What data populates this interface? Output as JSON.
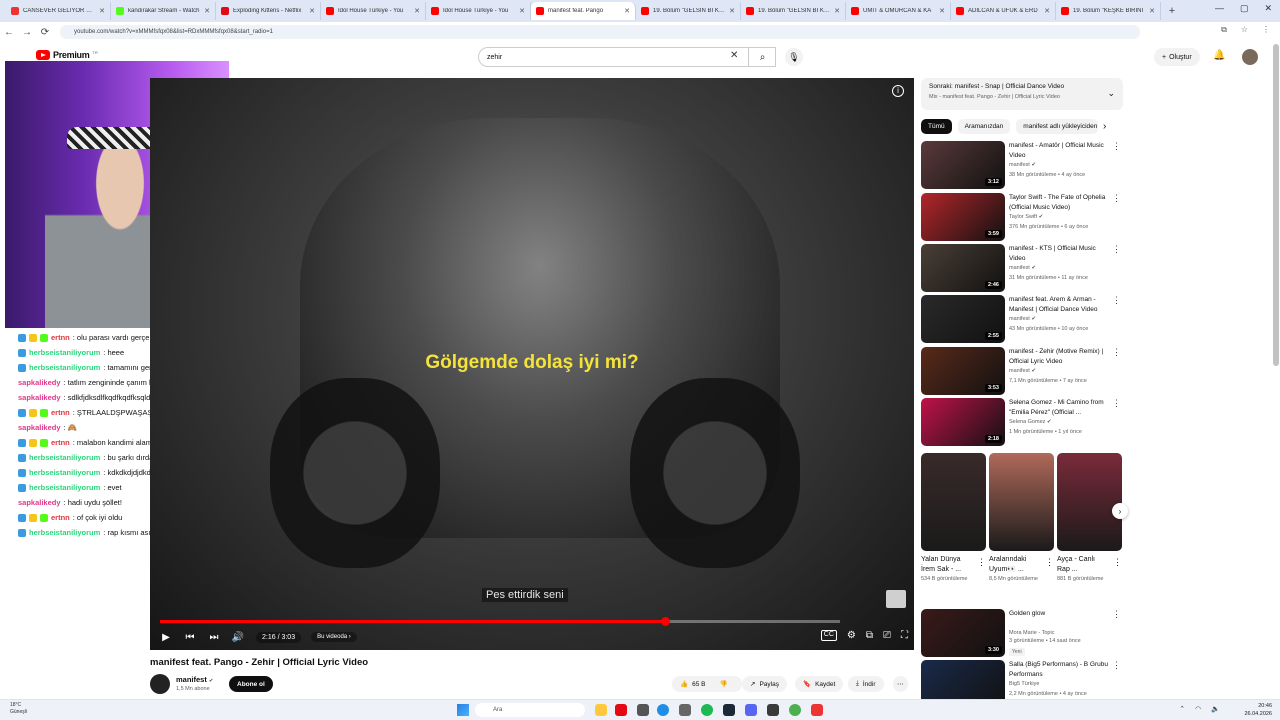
{
  "browser": {
    "tabs": [
      {
        "title": "CANSEVER GELİYOR GELİ",
        "color": "#e33"
      },
      {
        "title": "kandırakar Stream - Watch",
        "color": "#53fc18"
      },
      {
        "title": "Exploding Kittens - Netflix",
        "color": "#e50914"
      },
      {
        "title": "İdol House Türkiye - You",
        "color": "#f00"
      },
      {
        "title": "İdol House Türkiye - You",
        "color": "#f00"
      },
      {
        "title": "manifest feat. Pango",
        "color": "#f00",
        "active": true
      },
      {
        "title": "19. Bölüm \"GELSİN Bİ KİŞİ",
        "color": "#f00"
      },
      {
        "title": "19. Bölüm \"GELSİN Bİ KİŞİ",
        "color": "#f00"
      },
      {
        "title": "ÜMİT & OMURCAN & KA",
        "color": "#f00"
      },
      {
        "title": "ADİLCAN & UFUK & ERD",
        "color": "#f00"
      },
      {
        "title": "19. Bölüm \"KEŞKE BİRİNİ",
        "color": "#f00"
      }
    ],
    "new_tab": "+",
    "window_controls": {
      "minimize": "—",
      "maximize": "▢",
      "close": "✕"
    },
    "url": "youtube.com/watch?v=xMMMfsfqx08&list=RDxMMMfsfqx08&start_radio=1",
    "nav": {
      "back": "←",
      "forward": "→",
      "reload": "⟳"
    }
  },
  "header": {
    "logo_text": "Premium",
    "logo_cc": "TR",
    "search_value": "zehir",
    "search_clear": "✕",
    "search_icon": "⌕",
    "mic_icon": "🎙",
    "create_label": "Oluştur",
    "bell_icon": "🔔"
  },
  "chat": [
    {
      "user": "ertnn",
      "color": "#e0363c",
      "msg": ": olu parası vardı gerçek yatmadı",
      "badges": [
        "#3a9be0",
        "#f5c518",
        "#53fc18"
      ]
    },
    {
      "user": "herbseistaniliyorum",
      "color": "#29d67c",
      "msg": ": heee",
      "badges": [
        "#3a9be0"
      ]
    },
    {
      "user": "herbseistaniliyorum",
      "color": "#29d67c",
      "msg": ": tamamını gençsinn",
      "badges": [
        "#3a9be0"
      ]
    },
    {
      "user": "sapkalikedy",
      "color": "#e0368a",
      "msg": ": tatlım zengininde çanım bizi de gör",
      "badges": []
    },
    {
      "user": "sapkalikedy",
      "color": "#e0368a",
      "msg": ": sdlkfjdksdlfkqdfkqdfksqldf",
      "badges": []
    },
    {
      "user": "ertnn",
      "color": "#e0363c",
      "msg": ": ŞTRLAALDŞPWAŞAŞFÜU",
      "badges": [
        "#3a9be0",
        "#f5c518",
        "#53fc18"
      ]
    },
    {
      "user": "sapkalikedy",
      "color": "#e0368a",
      "msg": ": 🙈",
      "badges": []
    },
    {
      "user": "ertnn",
      "color": "#e0363c",
      "msg": ": malabon kandimi alamamam çok sacma bu arada",
      "badges": [
        "#3a9be0",
        "#f5c518",
        "#53fc18"
      ]
    },
    {
      "user": "herbseistaniliyorum",
      "color": "#29d67c",
      "msg": ": bu şarkı dırdan yapılmış",
      "badges": [
        "#3a9be0"
      ]
    },
    {
      "user": "herbseistaniliyorum",
      "color": "#29d67c",
      "msg": ": kdkdkdjdjdkd",
      "badges": [
        "#3a9be0"
      ]
    },
    {
      "user": "herbseistaniliyorum",
      "color": "#29d67c",
      "msg": ": evet",
      "badges": [
        "#3a9be0"
      ]
    },
    {
      "user": "sapkalikedy",
      "color": "#e0368a",
      "msg": ": hadi uydu şöllet!",
      "badges": []
    },
    {
      "user": "ertnn",
      "color": "#e0363c",
      "msg": ": of çok iyi oldu",
      "badges": [
        "#3a9be0",
        "#f5c518",
        "#53fc18"
      ]
    },
    {
      "user": "herbseistaniliyorum",
      "color": "#29d67c",
      "msg": ": rap kısmı asırı güzel oldu",
      "badges": [
        "#3a9be0"
      ]
    }
  ],
  "player": {
    "lyric": "Gölgemde dolaş iyi mi?",
    "subtitle": "Pes ettirdik seni",
    "time": "2:16 / 3:03",
    "progress": 0.743,
    "chapters_label": "Bu videoda",
    "icons": {
      "play": "▶",
      "prev": "⏮",
      "next": "⏭",
      "volume": "🔊",
      "cc": "CC",
      "settings": "⚙",
      "miniplayer": "⧉",
      "cast": "⎚",
      "fullscreen": "⛶",
      "info": "i"
    }
  },
  "video": {
    "title": "manifest feat. Pango - Zehir | Official Lyric Video",
    "channel": "manifest",
    "verified": "✔",
    "subs": "1,5 Mn abone",
    "subscribe": "Abone ol",
    "likes": "65 B",
    "share": "Paylaş",
    "save": "Kaydet",
    "download": "İndir",
    "more": "⋯"
  },
  "sidebar": {
    "upnext_title": "Sonraki: manifest - Snap | Official Dance Video",
    "upnext_sub": "Mix - manifest feat. Pango - Zehir | Official Lyric Video",
    "chips": [
      "Tümü",
      "Aramanızdan",
      "manifest adlı yükleyiciden"
    ],
    "recs": [
      {
        "title": "manifest - Amatör | Official Music Video",
        "channel": "manifest",
        "meta": "38 Mn görüntüleme • 4 ay önce",
        "dur": "3:12",
        "thumb": "#5a3a3a",
        "verified": true
      },
      {
        "title": "Taylor Swift - The Fate of Ophelia (Official Music Video)",
        "channel": "Taylor Swift",
        "meta": "376 Mn görüntüleme • 6 ay önce",
        "dur": "3:59",
        "thumb": "#b3262a",
        "verified": true
      },
      {
        "title": "manifest - KTS | Official Music Video",
        "channel": "manifest",
        "meta": "31 Mn görüntüleme • 11 ay önce",
        "dur": "2:46",
        "thumb": "#4a3f36",
        "verified": true
      },
      {
        "title": "manifest feat. Arem & Arman - Manifest | Official Dance Video",
        "channel": "manifest",
        "meta": "43 Mn görüntüleme • 10 ay önce",
        "dur": "2:55",
        "thumb": "#2a2a2a",
        "verified": true
      },
      {
        "title": "manifest - Zehir (Motive Remix) | Official Lyric Video",
        "channel": "manifest",
        "meta": "7,1 Mn görüntüleme • 7 ay önce",
        "dur": "3:53",
        "thumb": "#5a2a1a",
        "verified": true
      },
      {
        "title": "Selena Gomez - Mi Camino from \"Emilia Pérez\" (Official ...",
        "channel": "Selena Gomez",
        "meta": "1 Mn görüntüleme • 1 yıl önce",
        "dur": "2:18",
        "thumb": "#c0124a",
        "verified": true
      },
      {
        "title": "Golden glow",
        "channel": "Mora Marie - Topic",
        "meta": "3 görüntüleme • 14 saat önce",
        "dur": "3:30",
        "thumb": "#3a1a1a",
        "verified": false,
        "new": "Yeni"
      },
      {
        "title": "Salla (Big5 Performans) - B Grubu Performans",
        "channel": "Big5 Türkiye",
        "meta": "2,2 Mn görüntüleme • 4 ay önce",
        "dur": "",
        "thumb": "#1a2a4a",
        "verified": false
      }
    ],
    "shorts": [
      {
        "title": "Yalan Dünya İrem Sak - ...",
        "views": "534 B görüntüleme",
        "thumb": "#3a2a2a"
      },
      {
        "title": "Aralarındaki Uyum👀 ...",
        "views": "8,5 Mn görüntüleme",
        "thumb": "#b06a5a"
      },
      {
        "title": "Ayça - Canlı Rap ...",
        "views": "881 B görüntüleme",
        "thumb": "#7a2a3a"
      }
    ],
    "shorts_next": "›",
    "chips_next": "›"
  },
  "taskbar": {
    "weather_temp": "18°C",
    "weather_desc": "Güneşli",
    "search_placeholder": "Ara",
    "time": "20:46",
    "date": "26.04.2026"
  }
}
